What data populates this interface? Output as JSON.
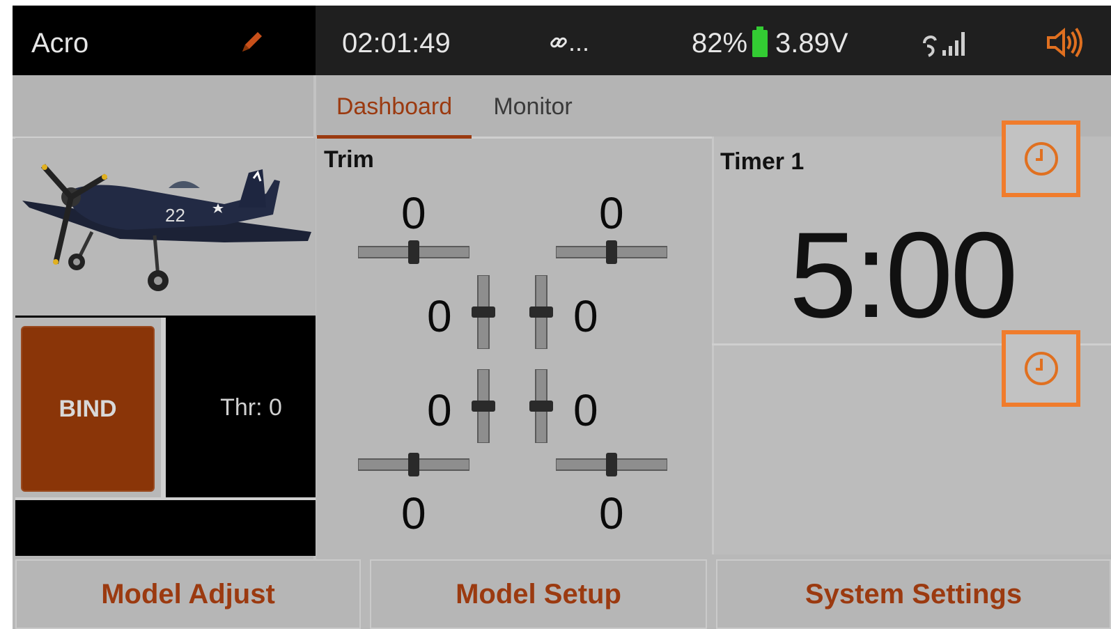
{
  "status_bar": {
    "model_name": "Acro",
    "clock": "02:01:49",
    "link_status": "...",
    "battery_percent": "82%",
    "battery_voltage": "3.89V",
    "icons": [
      "edit-icon",
      "link-icon",
      "battery-icon",
      "signal-icon",
      "volume-icon"
    ]
  },
  "tabs": [
    {
      "label": "Dashboard",
      "active": true
    },
    {
      "label": "Monitor",
      "active": false
    }
  ],
  "left_panel": {
    "bind_label": "BIND",
    "throttle_label": "Thr: 0"
  },
  "trim": {
    "title": "Trim",
    "top_left": "0",
    "top_right": "0",
    "mid_left_upper": "0",
    "mid_right_upper": "0",
    "mid_left_lower": "0",
    "mid_right_lower": "0",
    "bottom_left": "0",
    "bottom_right": "0"
  },
  "timer": {
    "title": "Timer 1",
    "value": "5:00"
  },
  "bottom_nav": [
    {
      "label": "Model Adjust"
    },
    {
      "label": "Model Setup"
    },
    {
      "label": "System Settings"
    }
  ],
  "colors": {
    "accent": "#9b3a10",
    "highlight": "#f07c2c",
    "bind_button": "#8a3508",
    "battery": "#33cc33"
  }
}
